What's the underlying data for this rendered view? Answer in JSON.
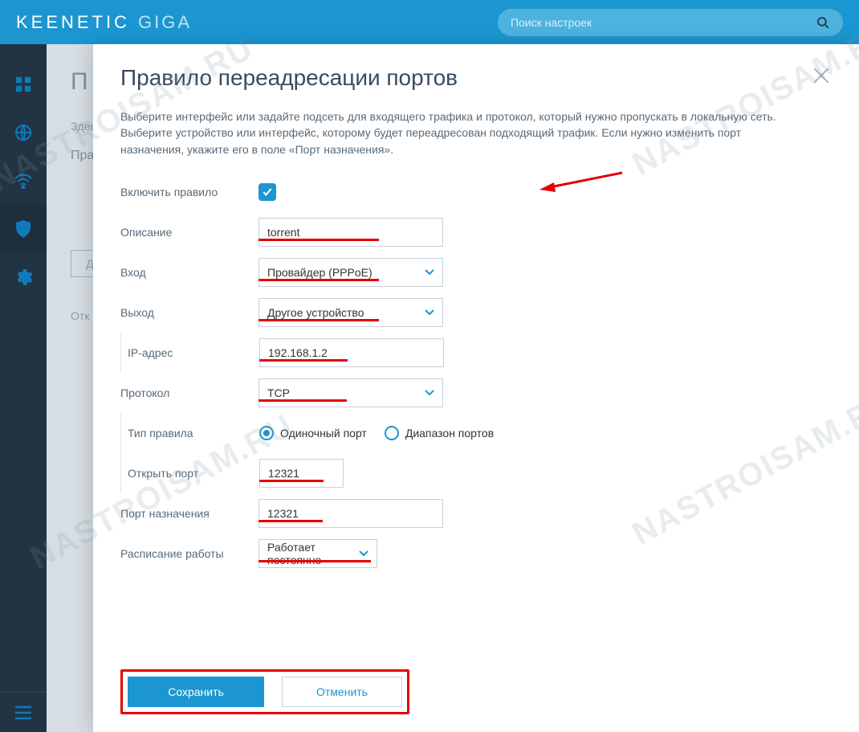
{
  "brand": {
    "main": "KEENETIC",
    "sub": "GIGA"
  },
  "search": {
    "placeholder": "Поиск настроек"
  },
  "background": {
    "title_fragment": "П",
    "line1": "Здес",
    "subheading": "Пра",
    "button_fragment": "Д",
    "row_fragment": "Отк"
  },
  "modal": {
    "title": "Правило переадресации портов",
    "description": "Выберите интерфейс или задайте подсеть для входящего трафика и протокол, который нужно пропускать в локальную сеть. Выберите устройство или интерфейс, которому будет переадресован подходящий трафик. Если нужно изменить порт назначения, укажите его в поле «Порт назначения».",
    "fields": {
      "enable_label": "Включить правило",
      "description_label": "Описание",
      "description_value": "torrent",
      "input_label": "Вход",
      "input_value": "Провайдер (PPPoE)",
      "output_label": "Выход",
      "output_value": "Другое устройство",
      "ip_label": "IP-адрес",
      "ip_value": "192.168.1.2",
      "protocol_label": "Протокол",
      "protocol_value": "TCP",
      "rule_type_label": "Тип правила",
      "rt_single": "Одиночный порт",
      "rt_range": "Диапазон портов",
      "open_port_label": "Открыть порт",
      "open_port_value": "12321",
      "dest_port_label": "Порт назначения",
      "dest_port_value": "12321",
      "schedule_label": "Расписание работы",
      "schedule_value": "Работает постоянно"
    },
    "buttons": {
      "save": "Сохранить",
      "cancel": "Отменить"
    }
  },
  "watermark": "NASTROISAM.RU"
}
